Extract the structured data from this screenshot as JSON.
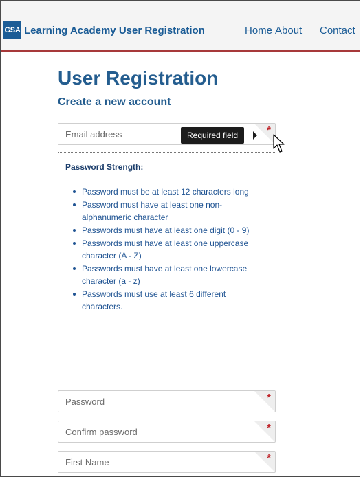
{
  "header": {
    "logo": "GSA",
    "brand": "Learning Academy User Registration",
    "nav": [
      {
        "label": "Home"
      },
      {
        "label": "About"
      },
      {
        "label": "Contact"
      }
    ]
  },
  "page": {
    "title": "User Registration",
    "subtitle": "Create a new account"
  },
  "form": {
    "email": {
      "placeholder": "Email address",
      "required_marker": "*"
    },
    "tooltip": "Required field",
    "password_strength": {
      "heading": "Password Strength:",
      "rules": [
        "Password must be at least 12 characters long",
        "Password must have at least one non-alphanumeric character",
        "Passwords must have at least one digit (0 - 9)",
        "Passwords must have at least one uppercase character (A - Z)",
        "Passwords must have at least one lowercase character (a - z)",
        "Passwords must use at least 6 different characters."
      ]
    },
    "password": {
      "placeholder": "Password",
      "required_marker": "*"
    },
    "confirm_password": {
      "placeholder": "Confirm password",
      "required_marker": "*"
    },
    "first_name": {
      "placeholder": "First Name",
      "required_marker": "*"
    }
  },
  "colors": {
    "brand_blue": "#1b5c96",
    "nav_border": "#a7393a",
    "required_red": "#c0262c"
  }
}
